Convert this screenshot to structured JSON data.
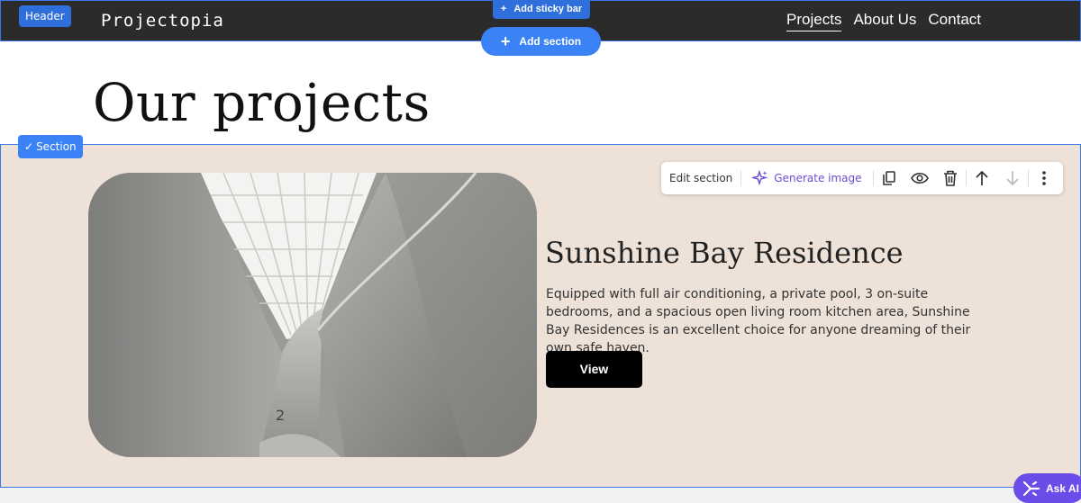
{
  "header": {
    "tag": "Header",
    "logo": "Projectopia",
    "nav": [
      "Projects",
      "About Us",
      "Contact"
    ]
  },
  "editor": {
    "add_sticky_bar": "Add sticky bar",
    "add_section": "Add section",
    "section_tag": "Section",
    "ask_ai": "Ask AI",
    "toolbar": {
      "edit_section": "Edit section",
      "generate_image": "Generate image",
      "icons": [
        "duplicate-icon",
        "eye-icon",
        "trash-icon",
        "arrow-up-icon",
        "arrow-down-icon",
        "more-vertical-icon"
      ]
    }
  },
  "page": {
    "title": "Our projects"
  },
  "project": {
    "title": "Sunshine Bay Residence",
    "description": "Equipped with full air conditioning, a private pool, 3 on-suite bedrooms, and a spacious open living room kitchen area, Sunshine Bay Residences is an excellent choice for anyone dreaming of their own safe haven.",
    "button": "View"
  },
  "colors": {
    "header_bg": "#2b2b2b",
    "section_bg": "#ede1d8",
    "editor_blue": "#3b82f6",
    "ai_purple": "#6a4de8"
  }
}
